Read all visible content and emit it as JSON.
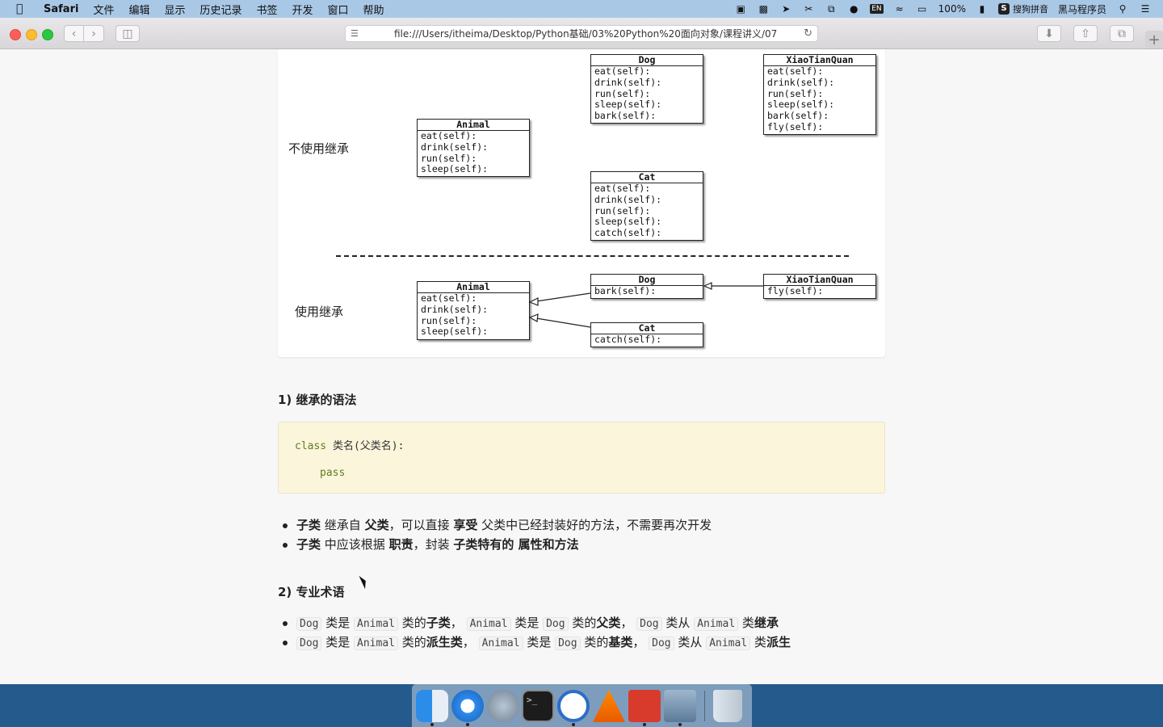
{
  "menubar": {
    "app": "Safari",
    "menus": [
      "文件",
      "编辑",
      "显示",
      "历史记录",
      "书签",
      "开发",
      "窗口",
      "帮助"
    ],
    "battery": "100%",
    "input_method_badge": "EN",
    "sogou": "搜狗拼音",
    "user": "黑马程序员"
  },
  "toolbar": {
    "url": "file:///Users/itheima/Desktop/Python基础/03%20Python%20面向对象/课程讲义/07"
  },
  "diagram": {
    "label_no_inherit": "不使用继承",
    "label_inherit": "使用继承",
    "top": {
      "dog": {
        "title": "Dog",
        "methods": "eat(self):\ndrink(self):\nrun(self):\nsleep(self):\nbark(self):"
      },
      "xtq": {
        "title": "XiaoTianQuan",
        "methods": "eat(self):\ndrink(self):\nrun(self):\nsleep(self):\nbark(self):\nfly(self):"
      },
      "animal": {
        "title": "Animal",
        "methods": "eat(self):\ndrink(self):\nrun(self):\nsleep(self):"
      },
      "cat": {
        "title": "Cat",
        "methods": "eat(self):\ndrink(self):\nrun(self):\nsleep(self):\ncatch(self):"
      }
    },
    "bottom": {
      "animal": {
        "title": "Animal",
        "methods": "eat(self):\ndrink(self):\nrun(self):\nsleep(self):"
      },
      "dog": {
        "title": "Dog",
        "methods": "bark(self):"
      },
      "xtq": {
        "title": "XiaoTianQuan",
        "methods": "fly(self):"
      },
      "cat": {
        "title": "Cat",
        "methods": "catch(self):"
      }
    }
  },
  "section1": {
    "title": "1) 继承的语法",
    "code_kw": "class",
    "code_rest": " 类名(父类名):",
    "code_line2": "pass",
    "bullets": [
      {
        "a": "子类",
        "b": " 继承自 ",
        "c": "父类",
        "d": "，可以直接 ",
        "e": "享受",
        "f": " 父类中已经封装好的方法，不需要再次开发"
      },
      {
        "a": "子类",
        "b": " 中应该根据 ",
        "c": "职责",
        "d": "，封装 ",
        "e": "子类特有的 属性和方法",
        "f": ""
      }
    ]
  },
  "section2": {
    "title": "2) 专业术语",
    "bullets": [
      {
        "c1": "Dog",
        "t1": " 类是 ",
        "c2": "Animal",
        "t2": " 类的",
        "b1": "子类",
        "t3": "， ",
        "c3": "Animal",
        "t4": " 类是 ",
        "c4": "Dog",
        "t5": " 类的",
        "b2": "父类",
        "t6": "， ",
        "c5": "Dog",
        "t7": " 类从 ",
        "c6": "Animal",
        "t8": " 类",
        "b3": "继承"
      },
      {
        "c1": "Dog",
        "t1": " 类是 ",
        "c2": "Animal",
        "t2": " 类的",
        "b1": "派生类",
        "t3": "， ",
        "c3": "Animal",
        "t4": " 类是 ",
        "c4": "Dog",
        "t5": " 类的",
        "b2": "基类",
        "t6": "， ",
        "c5": "Dog",
        "t7": " 类从 ",
        "c6": "Animal",
        "t8": " 类",
        "b3": "派生"
      }
    ]
  },
  "terminal_prompt": ">_",
  "colors": {
    "code_bg": "#fbf5dc",
    "code_keyword": "#5f7f1e",
    "menubar": "#a9c8e6"
  }
}
